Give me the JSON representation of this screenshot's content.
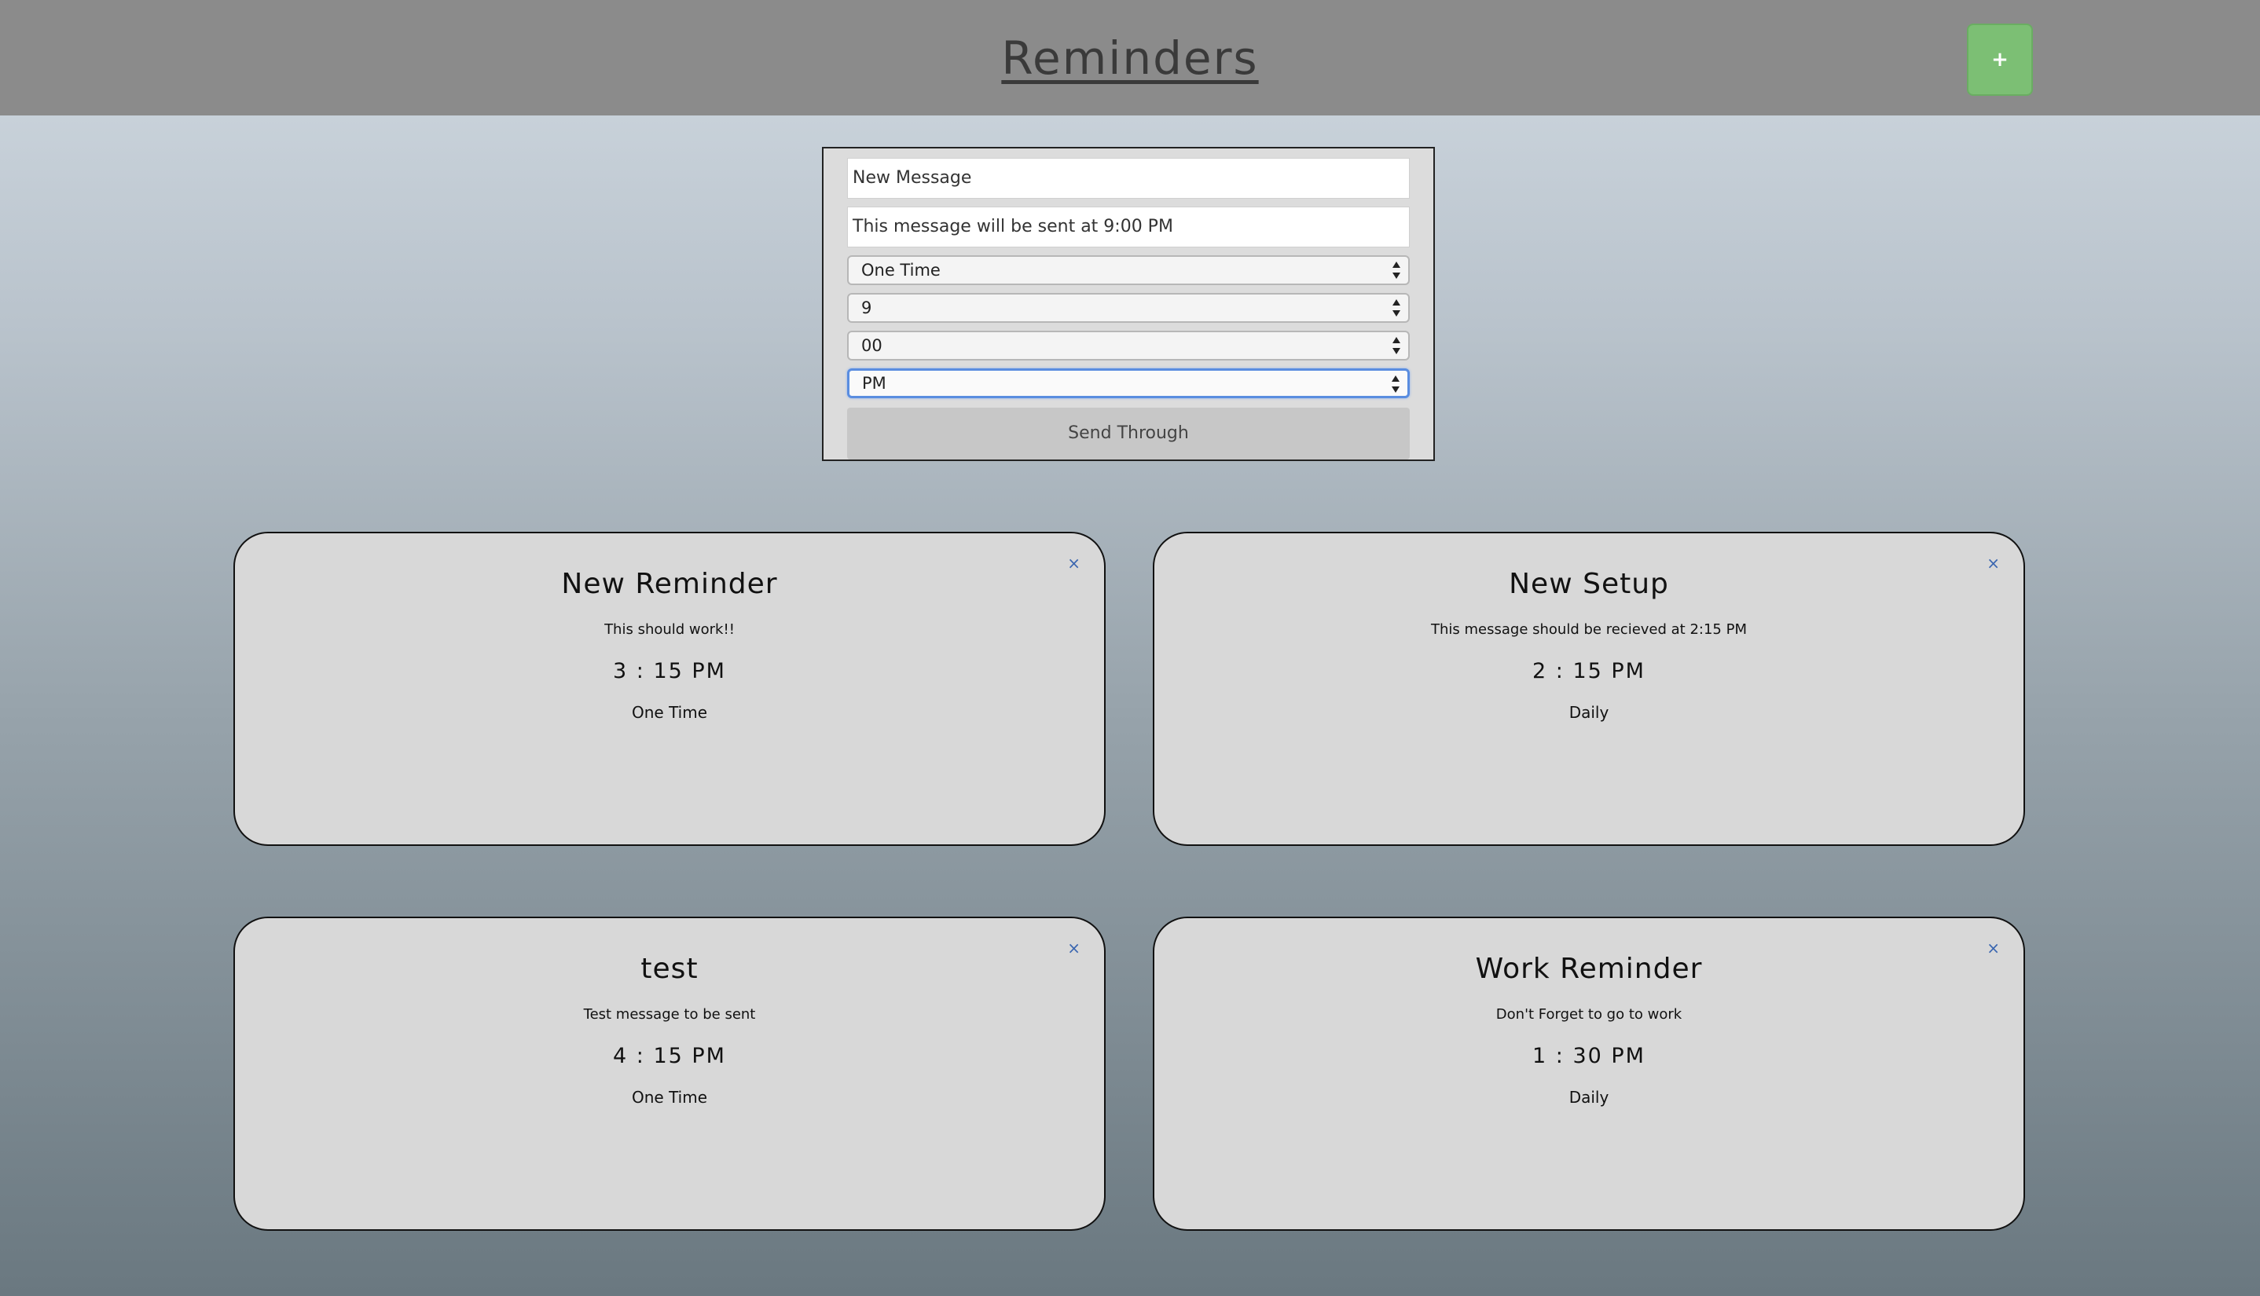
{
  "header": {
    "title": "Reminders",
    "add_label": "+"
  },
  "form": {
    "title_value": "New Message",
    "message_value": "This message will be sent at 9:00 PM",
    "frequency_value": "One Time",
    "hour_value": "9",
    "minute_value": "00",
    "period_value": "PM",
    "send_label": "Send Through"
  },
  "reminders": [
    {
      "title": "New Reminder",
      "message": "This should work!!",
      "time": "3 : 15 PM",
      "frequency": "One Time",
      "close": "×"
    },
    {
      "title": "New Setup",
      "message": "This message should be recieved at 2:15 PM",
      "time": "2 : 15 PM",
      "frequency": "Daily",
      "close": "×"
    },
    {
      "title": "test",
      "message": "Test message to be sent",
      "time": "4 : 15 PM",
      "frequency": "One Time",
      "close": "×"
    },
    {
      "title": "Work Reminder",
      "message": "Don't Forget to go to work",
      "time": "1 : 30 PM",
      "frequency": "Daily",
      "close": "×"
    }
  ],
  "colors": {
    "header_bg": "#8b8b8b",
    "add_button": "#7cbf74",
    "card_bg": "#d8d8d8",
    "focus_ring": "#5a8de0",
    "close_icon": "#3a66b0"
  }
}
